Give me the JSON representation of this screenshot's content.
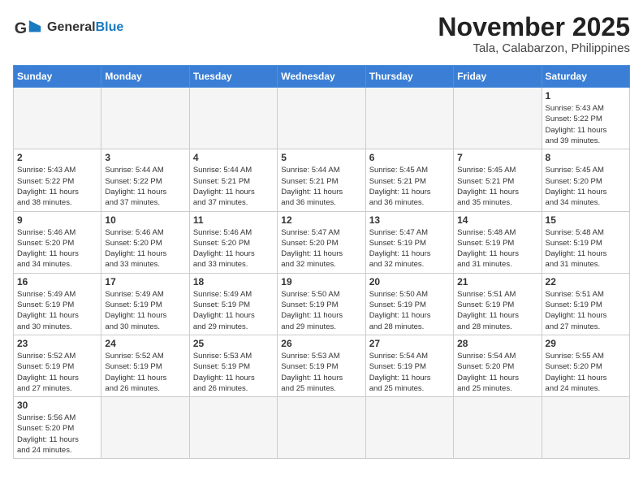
{
  "header": {
    "logo_text_general": "General",
    "logo_text_blue": "Blue",
    "month_title": "November 2025",
    "location": "Tala, Calabarzon, Philippines"
  },
  "days_of_week": [
    "Sunday",
    "Monday",
    "Tuesday",
    "Wednesday",
    "Thursday",
    "Friday",
    "Saturday"
  ],
  "weeks": [
    [
      {
        "day": "",
        "info": ""
      },
      {
        "day": "",
        "info": ""
      },
      {
        "day": "",
        "info": ""
      },
      {
        "day": "",
        "info": ""
      },
      {
        "day": "",
        "info": ""
      },
      {
        "day": "",
        "info": ""
      },
      {
        "day": "1",
        "info": "Sunrise: 5:43 AM\nSunset: 5:22 PM\nDaylight: 11 hours\nand 39 minutes."
      }
    ],
    [
      {
        "day": "2",
        "info": "Sunrise: 5:43 AM\nSunset: 5:22 PM\nDaylight: 11 hours\nand 38 minutes."
      },
      {
        "day": "3",
        "info": "Sunrise: 5:44 AM\nSunset: 5:22 PM\nDaylight: 11 hours\nand 37 minutes."
      },
      {
        "day": "4",
        "info": "Sunrise: 5:44 AM\nSunset: 5:21 PM\nDaylight: 11 hours\nand 37 minutes."
      },
      {
        "day": "5",
        "info": "Sunrise: 5:44 AM\nSunset: 5:21 PM\nDaylight: 11 hours\nand 36 minutes."
      },
      {
        "day": "6",
        "info": "Sunrise: 5:45 AM\nSunset: 5:21 PM\nDaylight: 11 hours\nand 36 minutes."
      },
      {
        "day": "7",
        "info": "Sunrise: 5:45 AM\nSunset: 5:21 PM\nDaylight: 11 hours\nand 35 minutes."
      },
      {
        "day": "8",
        "info": "Sunrise: 5:45 AM\nSunset: 5:20 PM\nDaylight: 11 hours\nand 34 minutes."
      }
    ],
    [
      {
        "day": "9",
        "info": "Sunrise: 5:46 AM\nSunset: 5:20 PM\nDaylight: 11 hours\nand 34 minutes."
      },
      {
        "day": "10",
        "info": "Sunrise: 5:46 AM\nSunset: 5:20 PM\nDaylight: 11 hours\nand 33 minutes."
      },
      {
        "day": "11",
        "info": "Sunrise: 5:46 AM\nSunset: 5:20 PM\nDaylight: 11 hours\nand 33 minutes."
      },
      {
        "day": "12",
        "info": "Sunrise: 5:47 AM\nSunset: 5:20 PM\nDaylight: 11 hours\nand 32 minutes."
      },
      {
        "day": "13",
        "info": "Sunrise: 5:47 AM\nSunset: 5:19 PM\nDaylight: 11 hours\nand 32 minutes."
      },
      {
        "day": "14",
        "info": "Sunrise: 5:48 AM\nSunset: 5:19 PM\nDaylight: 11 hours\nand 31 minutes."
      },
      {
        "day": "15",
        "info": "Sunrise: 5:48 AM\nSunset: 5:19 PM\nDaylight: 11 hours\nand 31 minutes."
      }
    ],
    [
      {
        "day": "16",
        "info": "Sunrise: 5:49 AM\nSunset: 5:19 PM\nDaylight: 11 hours\nand 30 minutes."
      },
      {
        "day": "17",
        "info": "Sunrise: 5:49 AM\nSunset: 5:19 PM\nDaylight: 11 hours\nand 30 minutes."
      },
      {
        "day": "18",
        "info": "Sunrise: 5:49 AM\nSunset: 5:19 PM\nDaylight: 11 hours\nand 29 minutes."
      },
      {
        "day": "19",
        "info": "Sunrise: 5:50 AM\nSunset: 5:19 PM\nDaylight: 11 hours\nand 29 minutes."
      },
      {
        "day": "20",
        "info": "Sunrise: 5:50 AM\nSunset: 5:19 PM\nDaylight: 11 hours\nand 28 minutes."
      },
      {
        "day": "21",
        "info": "Sunrise: 5:51 AM\nSunset: 5:19 PM\nDaylight: 11 hours\nand 28 minutes."
      },
      {
        "day": "22",
        "info": "Sunrise: 5:51 AM\nSunset: 5:19 PM\nDaylight: 11 hours\nand 27 minutes."
      }
    ],
    [
      {
        "day": "23",
        "info": "Sunrise: 5:52 AM\nSunset: 5:19 PM\nDaylight: 11 hours\nand 27 minutes."
      },
      {
        "day": "24",
        "info": "Sunrise: 5:52 AM\nSunset: 5:19 PM\nDaylight: 11 hours\nand 26 minutes."
      },
      {
        "day": "25",
        "info": "Sunrise: 5:53 AM\nSunset: 5:19 PM\nDaylight: 11 hours\nand 26 minutes."
      },
      {
        "day": "26",
        "info": "Sunrise: 5:53 AM\nSunset: 5:19 PM\nDaylight: 11 hours\nand 25 minutes."
      },
      {
        "day": "27",
        "info": "Sunrise: 5:54 AM\nSunset: 5:19 PM\nDaylight: 11 hours\nand 25 minutes."
      },
      {
        "day": "28",
        "info": "Sunrise: 5:54 AM\nSunset: 5:20 PM\nDaylight: 11 hours\nand 25 minutes."
      },
      {
        "day": "29",
        "info": "Sunrise: 5:55 AM\nSunset: 5:20 PM\nDaylight: 11 hours\nand 24 minutes."
      }
    ],
    [
      {
        "day": "30",
        "info": "Sunrise: 5:56 AM\nSunset: 5:20 PM\nDaylight: 11 hours\nand 24 minutes."
      },
      {
        "day": "",
        "info": ""
      },
      {
        "day": "",
        "info": ""
      },
      {
        "day": "",
        "info": ""
      },
      {
        "day": "",
        "info": ""
      },
      {
        "day": "",
        "info": ""
      },
      {
        "day": "",
        "info": ""
      }
    ]
  ]
}
